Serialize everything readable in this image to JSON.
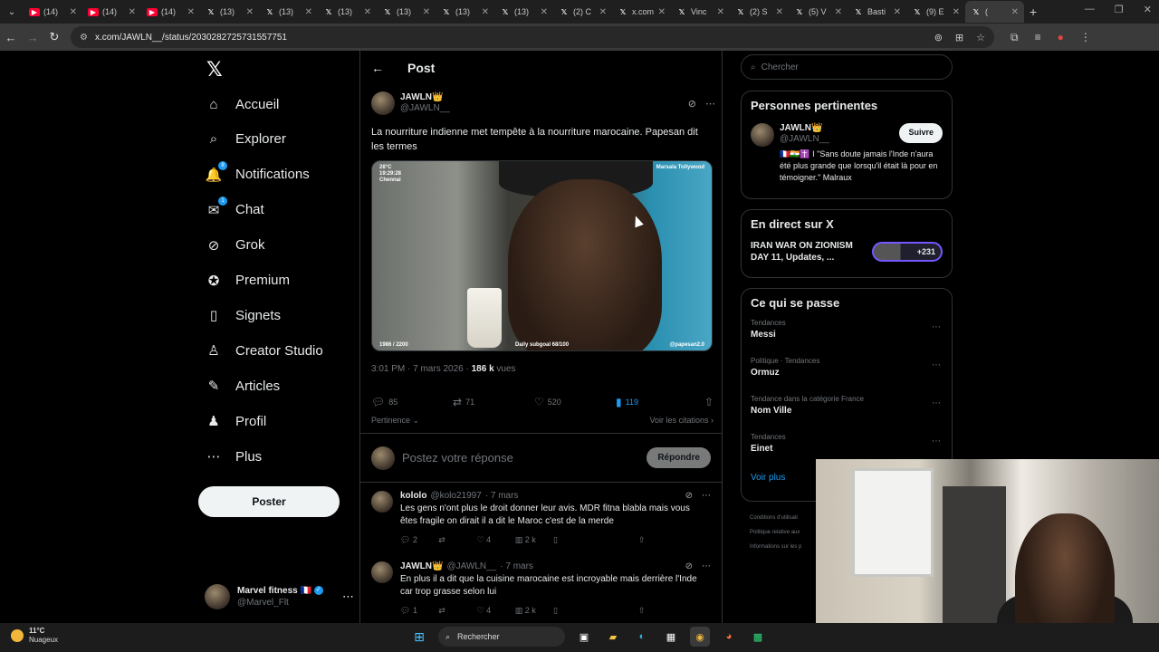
{
  "browser": {
    "tabs": [
      {
        "icon": "youtube-icon",
        "label": "(14)"
      },
      {
        "icon": "youtube-icon",
        "label": "(14)"
      },
      {
        "icon": "youtube-icon",
        "label": "(14)"
      },
      {
        "icon": "x-icon",
        "label": "(13)"
      },
      {
        "icon": "x-icon",
        "label": "(13)"
      },
      {
        "icon": "x-icon",
        "label": "(13)"
      },
      {
        "icon": "x-icon",
        "label": "(13)"
      },
      {
        "icon": "x-icon",
        "label": "(13)"
      },
      {
        "icon": "x-icon",
        "label": "(13)"
      },
      {
        "icon": "x-icon",
        "label": "(2) C"
      },
      {
        "icon": "x-icon",
        "label": "x.com"
      },
      {
        "icon": "x-icon",
        "label": "Vinc"
      },
      {
        "icon": "x-icon",
        "label": "(2) S"
      },
      {
        "icon": "x-icon",
        "label": "(5) V"
      },
      {
        "icon": "x-icon",
        "label": "Basti"
      },
      {
        "icon": "x-icon",
        "label": "(9) E"
      },
      {
        "icon": "x-icon",
        "label": "("
      }
    ],
    "url": "x.com/JAWLN__/status/2030282725731557751"
  },
  "nav": {
    "logo": "𝕏",
    "items": [
      {
        "label": "Accueil",
        "icon": "home-icon",
        "glyph": "⌂"
      },
      {
        "label": "Explorer",
        "icon": "search-icon",
        "glyph": "⌕"
      },
      {
        "label": "Notifications",
        "icon": "bell-icon",
        "glyph": "🔔",
        "badge": "8"
      },
      {
        "label": "Chat",
        "icon": "mail-icon",
        "glyph": "✉",
        "badge": "1"
      },
      {
        "label": "Grok",
        "icon": "grok-icon",
        "glyph": "⊘"
      },
      {
        "label": "Premium",
        "icon": "premium-icon",
        "glyph": "✪"
      },
      {
        "label": "Signets",
        "icon": "bookmark-icon",
        "glyph": "▯"
      },
      {
        "label": "Creator Studio",
        "icon": "creator-studio-icon",
        "glyph": "♙"
      },
      {
        "label": "Articles",
        "icon": "articles-icon",
        "glyph": "✎"
      },
      {
        "label": "Profil",
        "icon": "profile-icon",
        "glyph": "♟"
      },
      {
        "label": "Plus",
        "icon": "more-icon",
        "glyph": "⋯"
      }
    ],
    "post_button": "Poster",
    "account": {
      "name": "Marvel fitness 🇫🇷",
      "handle": "@Marvel_Flt"
    }
  },
  "main": {
    "header_title": "Post",
    "tweet": {
      "author_name": "JAWLN👑",
      "author_handle": "@JAWLN__",
      "text": "La nourriture indienne met tempête à la nourriture marocaine. Papesan dit les termes",
      "time": "3:01 PM · 7 mars 2026 · ",
      "views": "186 k",
      "views_label": " vues",
      "media_overlay": {
        "top_left": "28°C\n19:29:28\nChennai",
        "top_right": "Marsala Tollywood",
        "bottom_left": "1986 / 2200",
        "bottom_center": "Daily subgoal 68/100",
        "bottom_right": "@papesan2.0"
      },
      "stats": {
        "replies": "85",
        "reposts": "71",
        "likes": "520",
        "bookmarks": "119"
      },
      "relevance_label": "Pertinence",
      "quotes_label": "Voir les citations"
    },
    "reply_box": {
      "placeholder": "Postez votre réponse",
      "button": "Répondre"
    },
    "replies": [
      {
        "name": "kololo",
        "handle": "@kolo21997",
        "time": "· 7 mars",
        "text": "Les gens n'ont plus le droit donner leur avis. MDR fitna blabla mais vous êtes fragile on dirait il a dit le Maroc c'est de la merde",
        "replies": "2",
        "likes": "4",
        "views": "2 k"
      },
      {
        "name": "JAWLN👑",
        "handle": "@JAWLN__",
        "time": "· 7 mars",
        "text": "En plus il a dit que la cuisine marocaine est incroyable mais derrière l'Inde car trop grasse selon lui",
        "replies": "1",
        "likes": "4",
        "views": "2 k"
      }
    ]
  },
  "right": {
    "search_placeholder": "Chercher",
    "relevant_people": {
      "title": "Personnes pertinentes",
      "name": "JAWLN👑",
      "handle": "@JAWLN__",
      "follow": "Suivre",
      "bio": "🇫🇷🇮🇳✝️ I \"Sans doute jamais l'Inde n'aura été plus grande que lorsqu'il était là pour en témoigner.\" Malraux"
    },
    "live": {
      "title": "En direct sur X",
      "event": "IRAN WAR ON ZIONISM DAY 11, Updates, ...",
      "count": "+231"
    },
    "happening": {
      "title": "Ce qui se passe",
      "trends": [
        {
          "category": "Tendances",
          "name": "Messi"
        },
        {
          "category": "Politique · Tendances",
          "name": "Ormuz"
        },
        {
          "category": "Tendance dans la catégorie France",
          "name": "Nom Ville"
        },
        {
          "category": "Tendances",
          "name": "Einet"
        }
      ],
      "see_more": "Voir plus"
    },
    "footer": [
      "Conditions d'utilisati",
      "Politique relative aux",
      "Informations sur les p"
    ]
  },
  "taskbar": {
    "temp": "11°C",
    "weather": "Nuageux",
    "search": "Rechercher"
  }
}
